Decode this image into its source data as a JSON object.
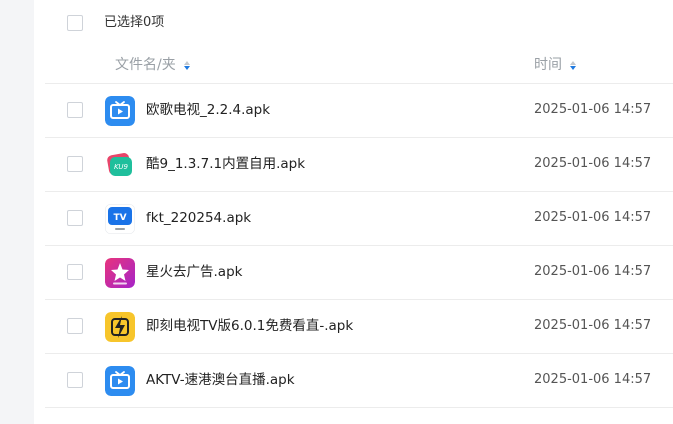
{
  "selection": {
    "label": "已选择0项"
  },
  "columns": {
    "name": "文件名/夹",
    "time": "时间"
  },
  "files": [
    {
      "name": "欧歌电视_2.2.4.apk",
      "time": "2025-01-06 14:57",
      "icon": "tv-play-icon"
    },
    {
      "name": "酷9_1.3.7.1内置自用.apk",
      "time": "2025-01-06 14:57",
      "icon": "ku9-app-icon"
    },
    {
      "name": "fkt_220254.apk",
      "time": "2025-01-06 14:57",
      "icon": "tv-badge-icon"
    },
    {
      "name": "星火去广告.apk",
      "time": "2025-01-06 14:57",
      "icon": "xinghuo-star-icon"
    },
    {
      "name": "即刻电视TV版6.0.1免费看直-.apk",
      "time": "2025-01-06 14:57",
      "icon": "lightning-icon"
    },
    {
      "name": "AKTV-速港澳台直播.apk",
      "time": "2025-01-06 14:57",
      "icon": "tv-play-icon"
    }
  ],
  "colors": {
    "accent": "#1f7ae0",
    "divider": "#ececec",
    "muted": "#9aa0a6"
  }
}
